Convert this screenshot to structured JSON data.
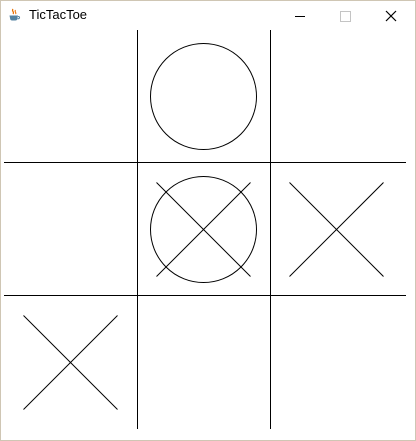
{
  "window": {
    "title": "TicTacToe",
    "icon": "java-cup-icon",
    "controls": [
      "minimize-icon",
      "maximize-icon",
      "close-icon"
    ]
  },
  "board": {
    "rows": 3,
    "cols": 3,
    "cells": [
      [
        "",
        "O",
        ""
      ],
      [
        "",
        "OX",
        "X"
      ],
      [
        "X",
        "",
        ""
      ]
    ],
    "line_color": "#000000"
  }
}
